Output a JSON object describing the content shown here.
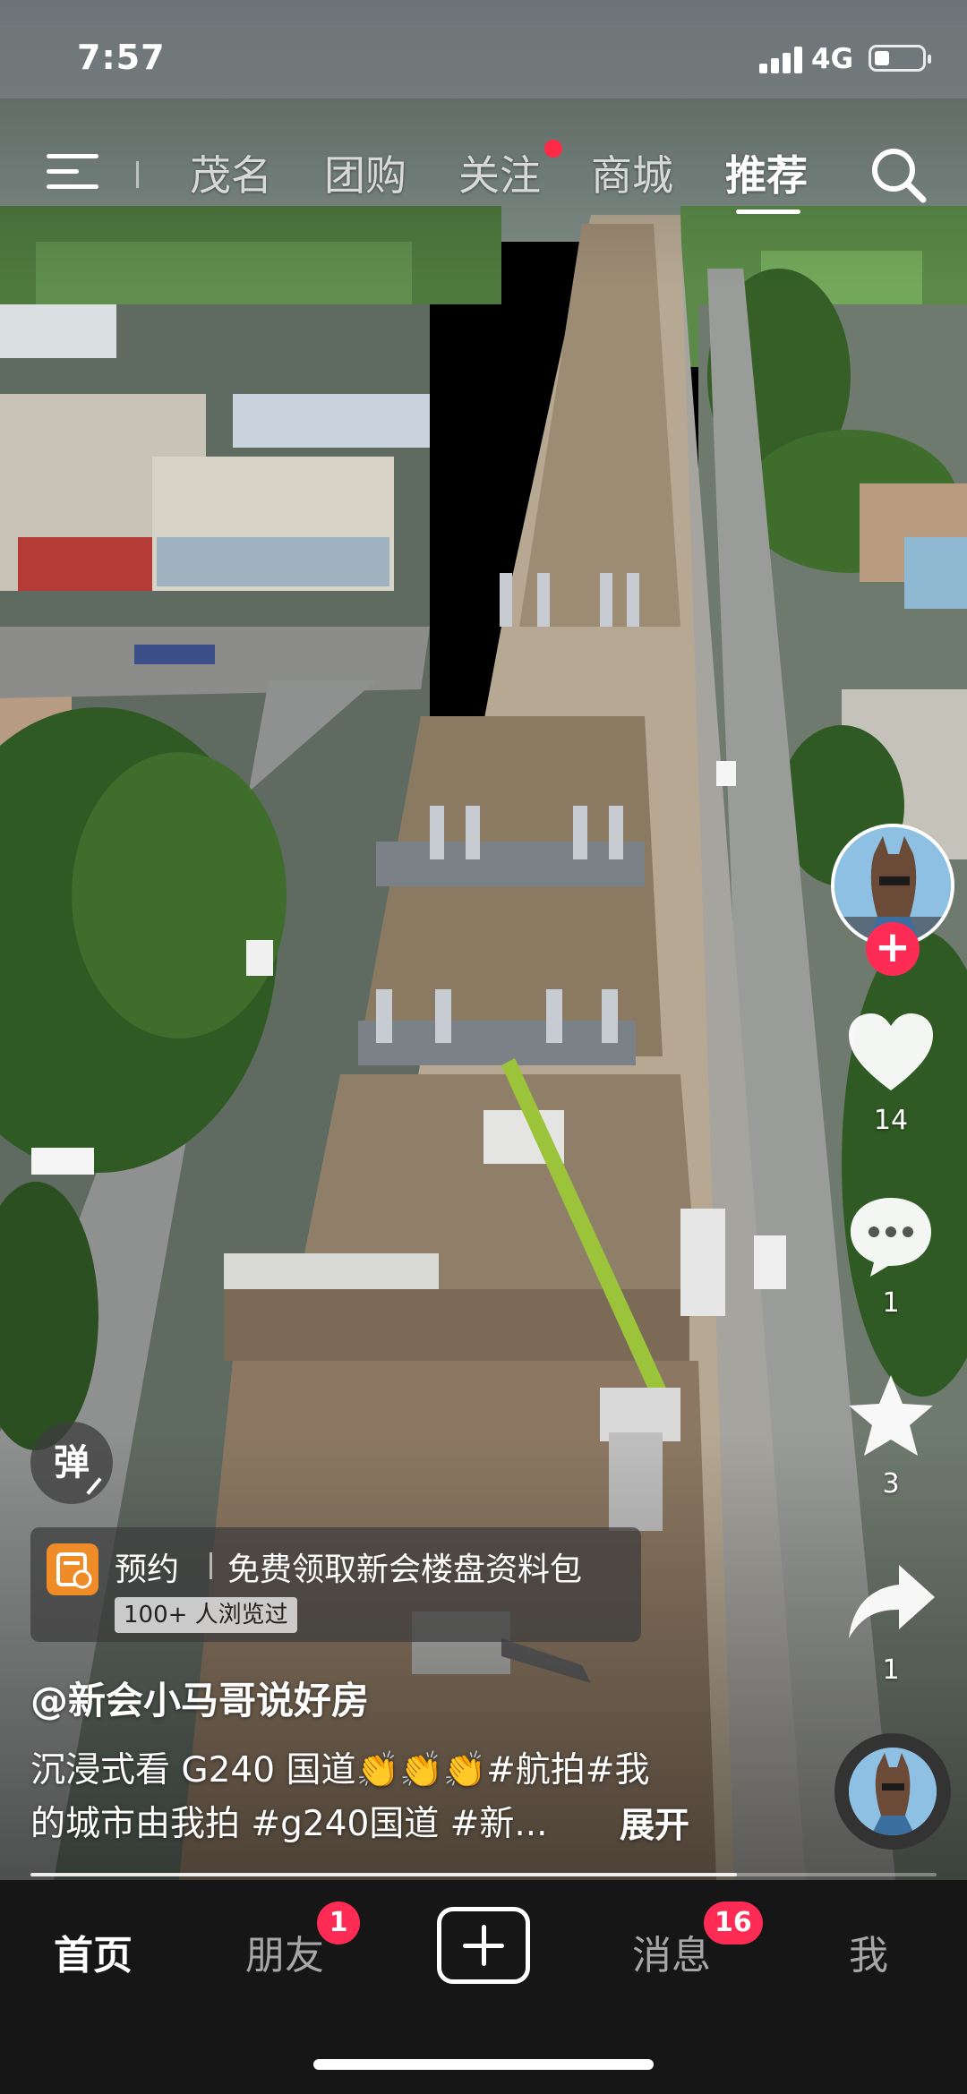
{
  "status_bar": {
    "time": "7:57",
    "network": "4G"
  },
  "top_nav": {
    "tabs": [
      {
        "label": "茂名"
      },
      {
        "label": "团购"
      },
      {
        "label": "关注"
      },
      {
        "label": "商城"
      },
      {
        "label": "推荐"
      }
    ],
    "active_tab": "推荐"
  },
  "video": {
    "description_source": "aerial view of road construction"
  },
  "right_rail": {
    "likes": "14",
    "comments": "1",
    "favorites": "3",
    "shares": "1",
    "icons": [
      "avatar",
      "plus-icon",
      "heart-icon",
      "comment-icon",
      "star-icon",
      "share-icon",
      "music-avatar"
    ]
  },
  "danmu": {
    "label": "弹"
  },
  "ad": {
    "title": "预约",
    "text": "免费领取新会楼盘资料包",
    "badge": "100+ 人浏览过"
  },
  "author": "@新会小马哥说好房",
  "caption": {
    "line1": "沉浸式看 G240 国道👏👏👏#航拍#我",
    "line2": "的城市由我拍 #g240国道 #新...",
    "expand": "展开"
  },
  "progress": {
    "fraction": 0.78
  },
  "tab_bar": {
    "home": "首页",
    "friends": "朋友",
    "friends_badge": "1",
    "messages": "消息",
    "messages_badge": "16",
    "me": "我"
  },
  "colors": {
    "accent": "#fe2c55",
    "tab_bar_bg": "#161616"
  }
}
